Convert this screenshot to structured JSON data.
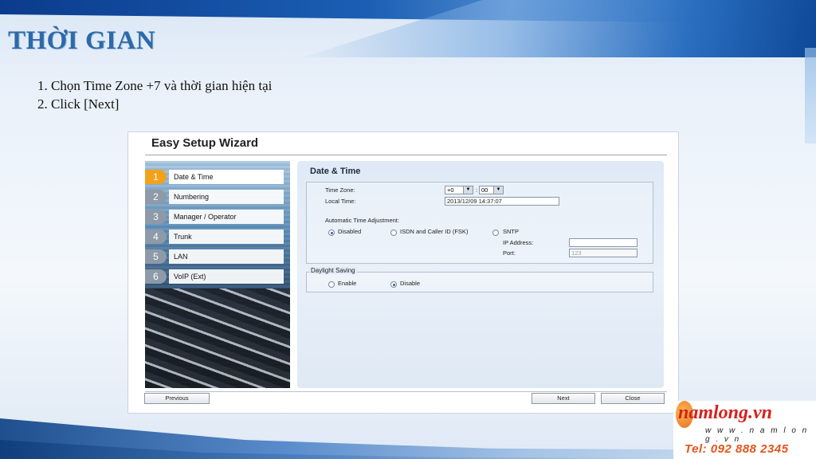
{
  "slide": {
    "title": "THỜI GIAN",
    "instructions": [
      "1. Chọn Time Zone +7 và thời gian hiện tại",
      "2. Click [Next]"
    ]
  },
  "wizard": {
    "title": "Easy Setup Wizard",
    "steps": [
      {
        "num": "1",
        "label": "Date & Time",
        "active": true
      },
      {
        "num": "2",
        "label": "Numbering"
      },
      {
        "num": "3",
        "label": "Manager / Operator"
      },
      {
        "num": "4",
        "label": "Trunk"
      },
      {
        "num": "5",
        "label": "LAN"
      },
      {
        "num": "6",
        "label": "VoIP (Ext)"
      }
    ],
    "content": {
      "title": "Date & Time",
      "time_zone_label": "Time Zone:",
      "time_zone_hours": "+0",
      "time_zone_sep": ":",
      "time_zone_minutes": "00",
      "local_time_label": "Local Time:",
      "local_time_value": "2013/12/09 14:37:07",
      "auto_adjust_label": "Automatic Time Adjustment:",
      "auto_options": {
        "disabled": "Disabled",
        "isdn": "ISDN and Caller ID (FSK)",
        "sntp": "SNTP"
      },
      "auto_selected": "Disabled",
      "ip_address_label": "IP Address:",
      "ip_address_value": "",
      "port_label": "Port:",
      "port_placeholder": "123",
      "daylight_saving_legend": "Daylight Saving",
      "dst_options": {
        "enable": "Enable",
        "disable": "Disable"
      },
      "dst_selected": "Disable"
    },
    "buttons": {
      "previous": "Previous",
      "next": "Next",
      "close": "Close"
    }
  },
  "logo": {
    "brand": "namlong.vn",
    "website": "w w w . n a m l o n g . v n",
    "tel": "Tel: 092 888 2345"
  },
  "colors": {
    "title": "#2d6aa8",
    "active_step": "#f2a11a",
    "logo_red": "#d6211b",
    "tel_orange": "#e6541b"
  }
}
